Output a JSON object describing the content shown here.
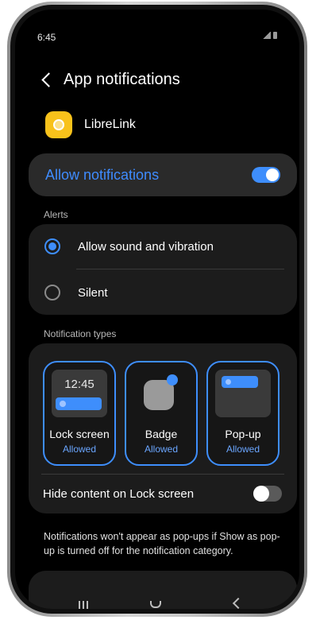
{
  "status_bar": {
    "time": "6:45"
  },
  "header": {
    "title": "App notifications"
  },
  "app": {
    "name": "LibreLink"
  },
  "allow_notifications": {
    "label": "Allow notifications",
    "enabled": true
  },
  "alerts": {
    "section_label": "Alerts",
    "options": [
      {
        "label": "Allow sound and vibration",
        "selected": true
      },
      {
        "label": "Silent",
        "selected": false
      }
    ]
  },
  "notification_types": {
    "section_label": "Notification types",
    "tiles": [
      {
        "title": "Lock screen",
        "status": "Allowed",
        "preview_time": "12:45"
      },
      {
        "title": "Badge",
        "status": "Allowed"
      },
      {
        "title": "Pop-up",
        "status": "Allowed"
      }
    ],
    "hide_content": {
      "label": "Hide content on Lock screen",
      "enabled": false
    }
  },
  "footnote": "Notifications won't appear as pop-ups if Show as pop-up is turned off for the notification category.",
  "colors": {
    "accent": "#3e8efc",
    "app_icon": "#f8c21b",
    "card": "#1c1c1c"
  }
}
